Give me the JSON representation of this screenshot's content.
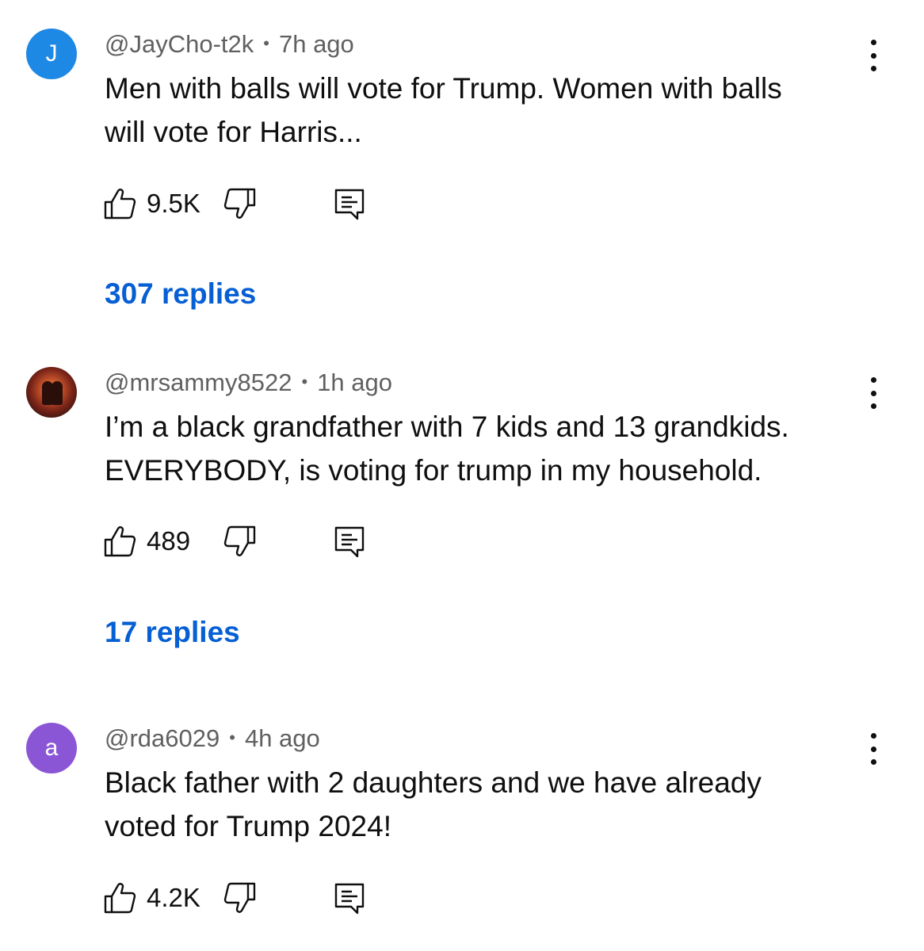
{
  "comments": [
    {
      "avatar_letter": "J",
      "avatar_color": "#1e88e5",
      "handle": "@JayCho-t2k",
      "separator": "•",
      "time": "7h ago",
      "text_line1": "Men with balls will vote for Trump. Women with balls",
      "text_line2": "will vote for Harris...",
      "likes": "9.5K",
      "replies": "307 replies"
    },
    {
      "avatar_letter": "",
      "avatar_color": "#7a2418",
      "handle": "@mrsammy8522",
      "separator": "•",
      "time": "1h ago",
      "text_line1": "I’m a black grandfather with 7 kids and 13 grandkids.",
      "text_line2": "EVERYBODY, is voting for trump in my household.",
      "likes": "489",
      "replies": "17 replies"
    },
    {
      "avatar_letter": "a",
      "avatar_color": "#8b56d6",
      "handle": "@rda6029",
      "separator": "•",
      "time": "4h ago",
      "text_line1": "Black father with 2 daughters and we have already",
      "text_line2": "voted for Trump 2024!",
      "likes": "4.2K"
    }
  ],
  "icons": {
    "like": "thumbs-up-icon",
    "dislike": "thumbs-down-icon",
    "reply": "reply-icon",
    "menu": "more-vert-icon"
  },
  "colors": {
    "link": "#065fd4",
    "meta": "#606060",
    "text": "#0f0f0f"
  }
}
